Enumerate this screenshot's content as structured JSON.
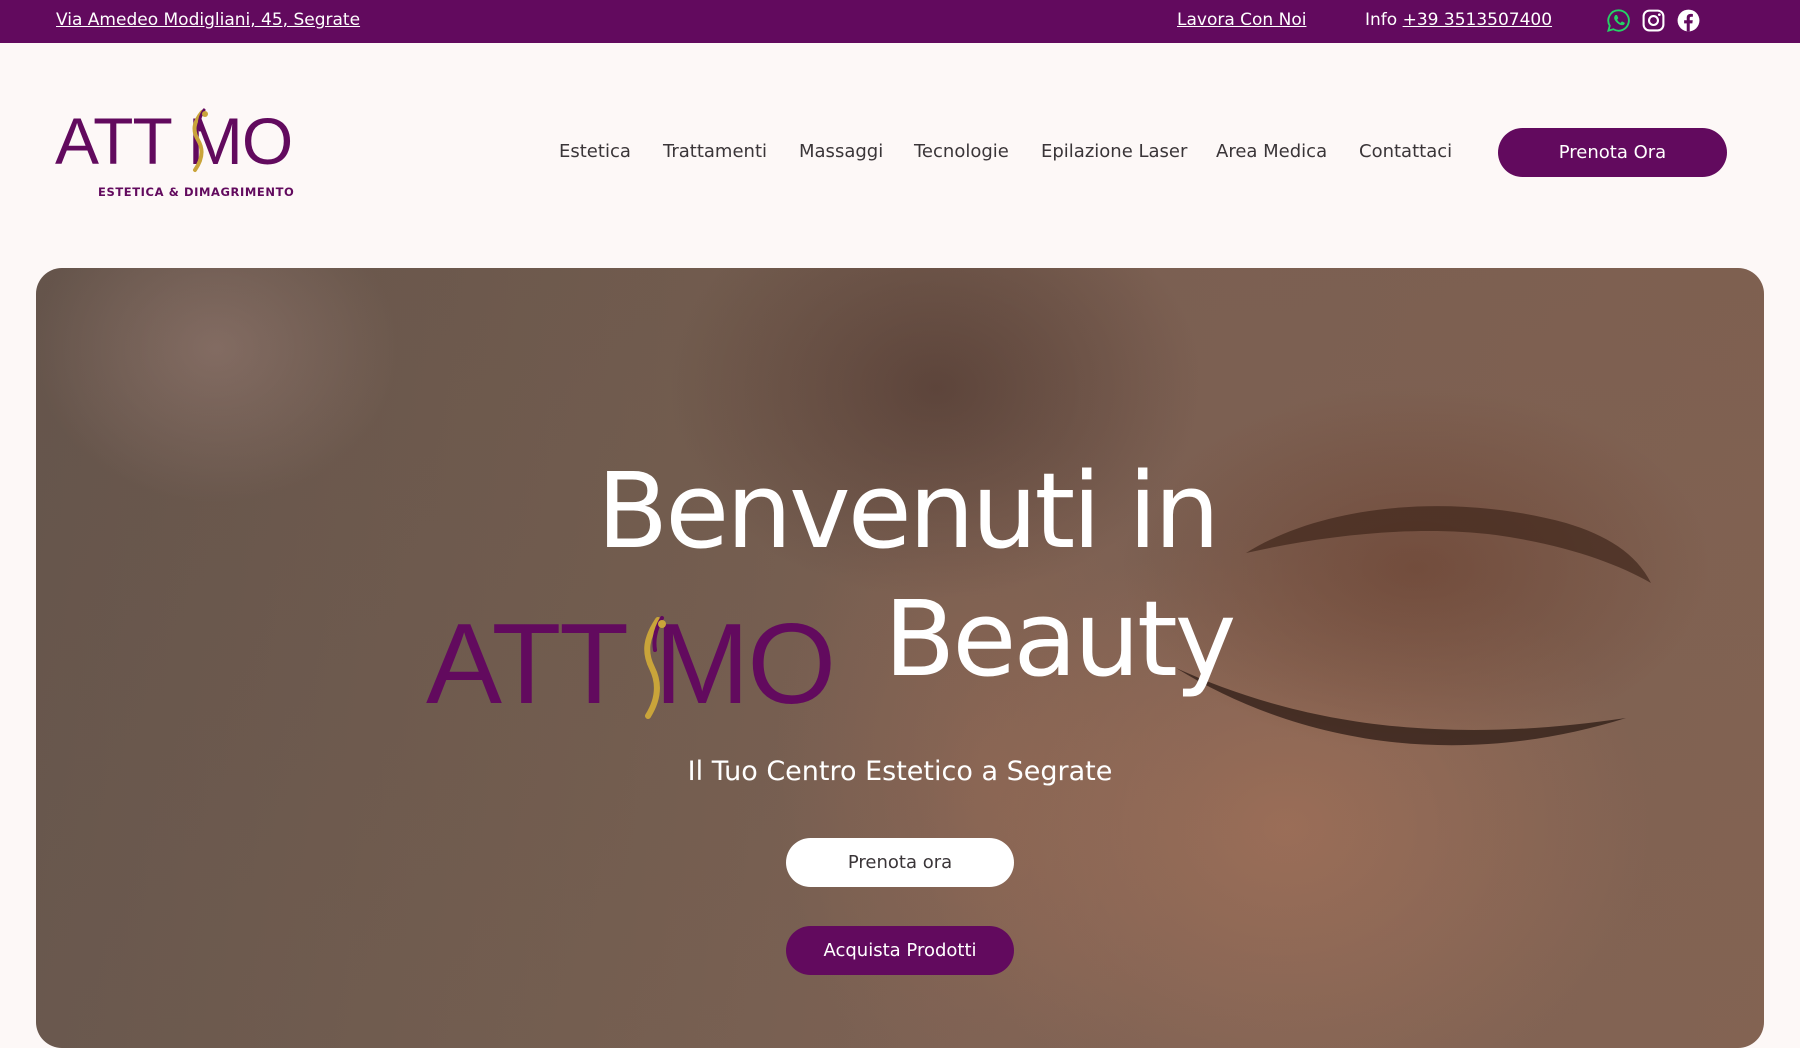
{
  "topbar": {
    "address": "Via Amedeo Modigliani, 45, Segrate",
    "work_with_us": "Lavora Con Noi",
    "info_label": "Info",
    "phone": "+39 3513507400",
    "social": [
      "whatsapp-icon",
      "instagram-icon",
      "facebook-icon"
    ]
  },
  "logo": {
    "word": "ATT MO",
    "tagline": "ESTETICA & DIMAGRIMENTO"
  },
  "nav": {
    "items": [
      "Estetica",
      "Trattamenti",
      "Massaggi",
      "Tecnologie",
      "Epilazione Laser",
      "Area Medica",
      "Contattaci"
    ],
    "cta": "Prenota Ora"
  },
  "hero": {
    "title_line1": "Benvenuti in",
    "brand": "ATT MO",
    "title_line2": "Beauty",
    "subtitle": "Il Tuo Centro Estetico a Segrate",
    "btn_book": "Prenota ora",
    "btn_shop": "Acquista Prodotti"
  },
  "colors": {
    "brand_purple": "#620a5e",
    "accent_gold": "#c9a43a",
    "background": "#fdf8f7",
    "whatsapp_green": "#25d366"
  }
}
